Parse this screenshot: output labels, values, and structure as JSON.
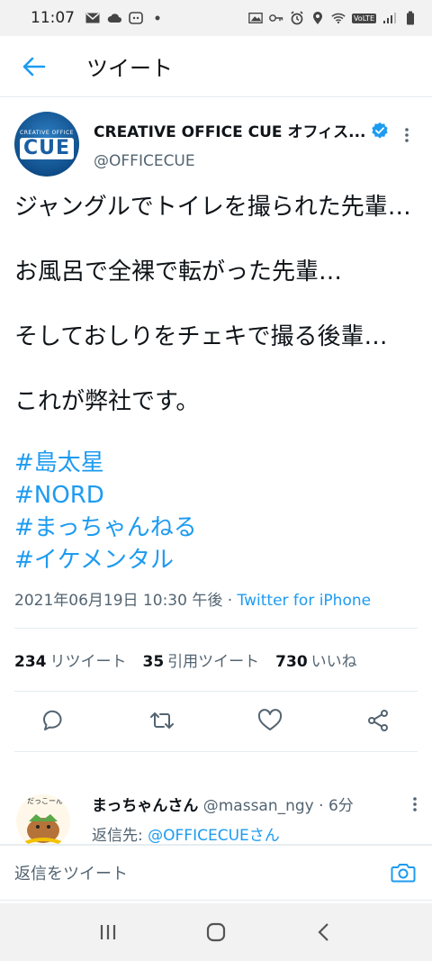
{
  "status": {
    "time": "11:07",
    "battery_label": "VoLTE"
  },
  "header": {
    "title": "ツイート"
  },
  "tweet": {
    "author_name": "CREATIVE OFFICE CUE オフィス...",
    "handle": "@OFFICECUE",
    "avatar_small_text": "CREATIVE OFFICE",
    "avatar_big_text": "CUE",
    "text_lines": [
      "ジャングルでトイレを撮られた先輩…",
      "お風呂で全裸で転がった先輩…",
      "そしておしりをチェキで撮る後輩…",
      "これが弊社です。"
    ],
    "hashtags": [
      "#島太星",
      "#NORD",
      "#まっちゃんねる",
      "#イケメンタル"
    ],
    "timestamp": "2021年06月19日 10:30 午後",
    "separator": " · ",
    "source": "Twitter for iPhone"
  },
  "stats": {
    "retweets_count": "234",
    "retweets_label": "リツイート",
    "quotes_count": "35",
    "quotes_label": "引用ツイート",
    "likes_count": "730",
    "likes_label": "いいね"
  },
  "reply": {
    "name": "まっちゃんさん",
    "handle": "@massan_ngy · 6分",
    "reply_to_label": "返信先: ",
    "reply_to_mention": "@OFFICECUEさん",
    "avatar_text": "だっこーん"
  },
  "compose": {
    "placeholder": "返信をツイート"
  },
  "colors": {
    "accent": "#1d9bf0",
    "text": "#0f1419",
    "secondary": "#536471"
  }
}
